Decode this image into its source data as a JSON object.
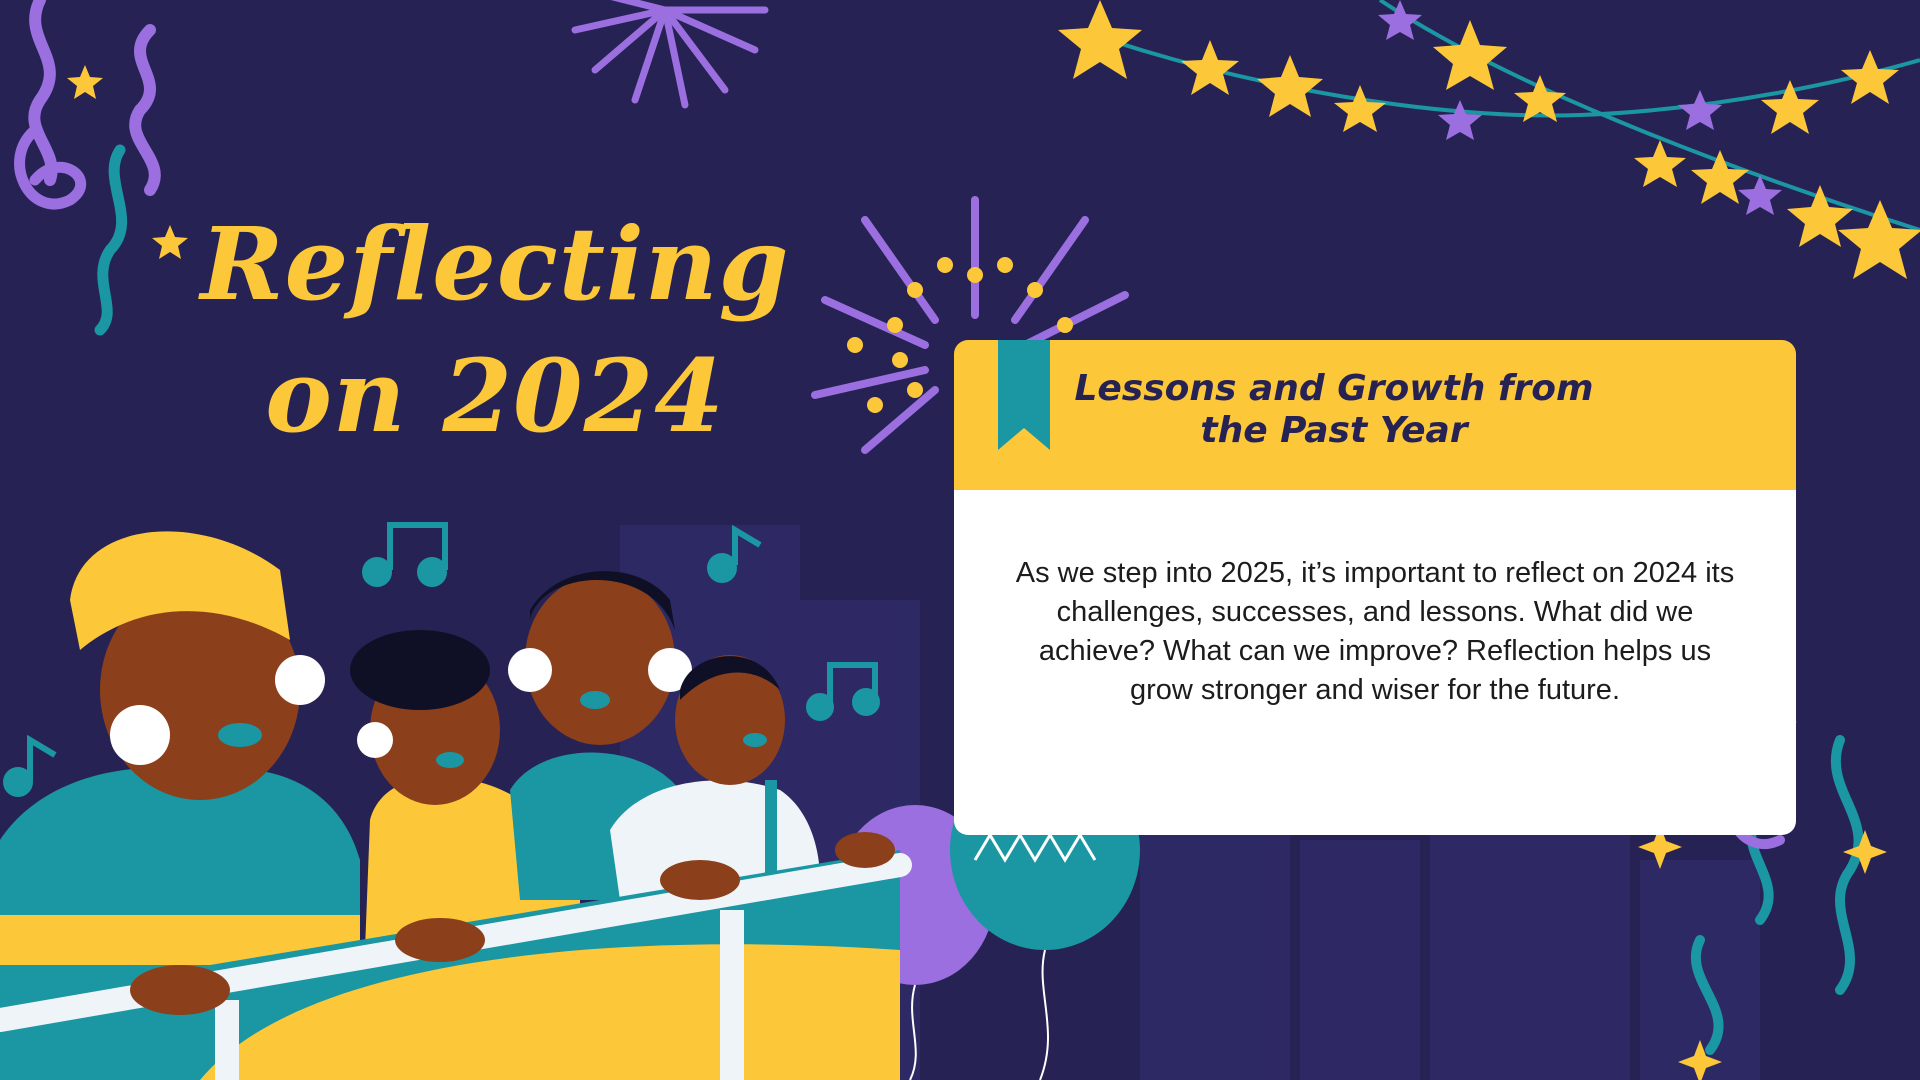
{
  "title": {
    "line1": "Reflecting",
    "line2": "on 2024"
  },
  "card": {
    "heading_line1": "Lessons and Growth from",
    "heading_line2": "the Past Year",
    "body": "As we step into 2025, it’s important to reflect on 2024 its challenges, successes, and lessons. What did we achieve? What can we improve? Reflection helps us grow stronger and wiser for the future."
  },
  "colors": {
    "background": "#272254",
    "accent_yellow": "#fcc839",
    "accent_teal": "#1b96a3",
    "accent_purple": "#9b6fe0",
    "card_body": "#ffffff"
  },
  "decor": {
    "icons": [
      "confetti-icon",
      "firework-icon",
      "star-garland-icon",
      "music-note-icon",
      "balloon-icon",
      "family-illustration"
    ]
  }
}
